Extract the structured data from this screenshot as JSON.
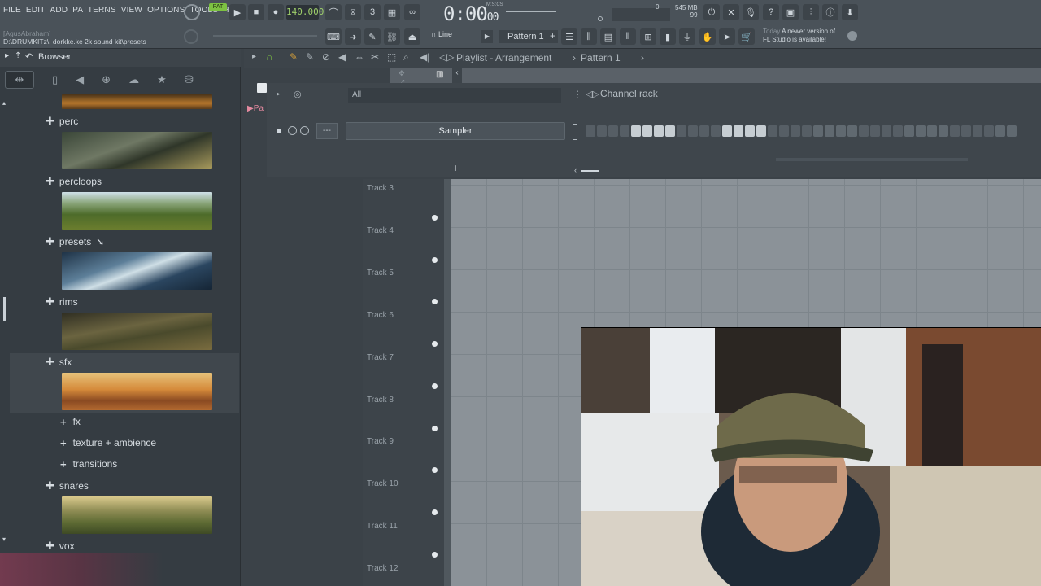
{
  "menu": [
    "FILE",
    "EDIT",
    "ADD",
    "PATTERNS",
    "VIEW",
    "OPTIONS",
    "TOOLS",
    "HELP"
  ],
  "transport": {
    "pat_label": "PAT",
    "tempo": "140.000",
    "time_main": "0:00",
    "time_sub": "00",
    "time_unit": "M:S:CS"
  },
  "memory": {
    "mb": "545 MB",
    "cpu": "99",
    "zero": "0"
  },
  "project": {
    "user": "[AgusAbraham]",
    "path": "D:\\DRUMKITz\\! dorkke.ke 2k sound kit\\presets"
  },
  "toolbar2": {
    "snap": "Line",
    "pattern": "Pattern 1"
  },
  "news": {
    "when": "Today",
    "text": "A newer version of FL Studio is available!"
  },
  "browser": {
    "title": "Browser",
    "folders": [
      {
        "name": "perc"
      },
      {
        "name": "percloops"
      },
      {
        "name": "presets"
      },
      {
        "name": "rims"
      },
      {
        "name": "sfx"
      },
      {
        "name": "snares"
      },
      {
        "name": "vox"
      }
    ],
    "subfolders": [
      "fx",
      "texture + ambience",
      "transitions"
    ]
  },
  "playlist": {
    "title": "Playlist - Arrangement",
    "pattern": "Pattern 1",
    "side_label": "Pa"
  },
  "channel_rack": {
    "filter": "All",
    "title": "Channel rack",
    "channel": "Sampler",
    "dash": "---"
  },
  "tracks": [
    "Track 3",
    "Track 4",
    "Track 5",
    "Track 6",
    "Track 7",
    "Track 8",
    "Track 9",
    "Track 10",
    "Track 11",
    "Track 12"
  ],
  "steps_on": [
    4,
    5,
    6,
    7,
    12,
    13,
    14,
    15
  ]
}
